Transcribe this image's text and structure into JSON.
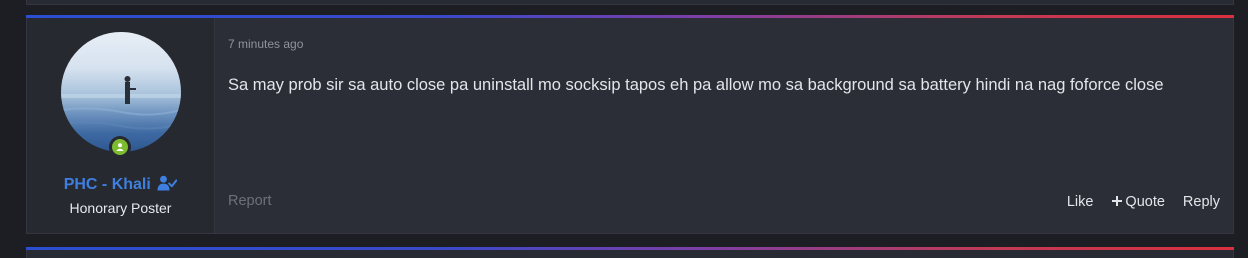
{
  "post": {
    "time": "7 minutes ago",
    "message": "Sa may prob sir sa auto close pa uninstall mo socksip tapos eh pa allow mo sa background sa battery hindi na nag foforce close",
    "report_label": "Report",
    "actions": {
      "like": "Like",
      "quote": "Quote",
      "reply": "Reply"
    }
  },
  "user": {
    "name": "PHC - Khali",
    "title": "Honorary Poster",
    "online": true
  },
  "colors": {
    "username": "#3f7fe0",
    "online_badge": "#7dbb2f",
    "accent_gradient": [
      "#2a4fd1",
      "#7a3fa8",
      "#d9303f"
    ]
  },
  "icons": [
    "user-check-icon",
    "online-status-icon",
    "plus-icon"
  ]
}
